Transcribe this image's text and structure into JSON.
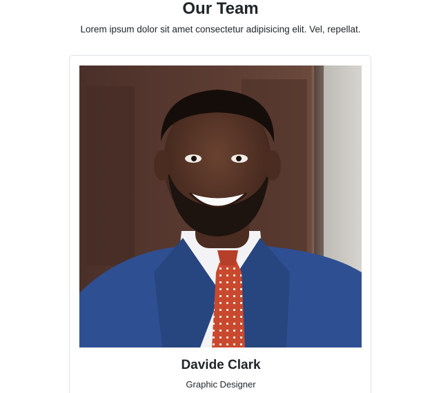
{
  "team": {
    "title": "Our Team",
    "subtitle": "Lorem ipsum dolor sit amet consectetur adipisicing elit. Vel, repellat."
  },
  "cards": [
    {
      "photo_icon": "portrait-photo",
      "name": "Davide Clark",
      "role": "Graphic Designer"
    }
  ],
  "colors": {
    "text": "#212529",
    "card_border": "#dee2e6",
    "suit": "#2f4f93",
    "tie": "#c9492f",
    "door": "#5a3b33"
  }
}
